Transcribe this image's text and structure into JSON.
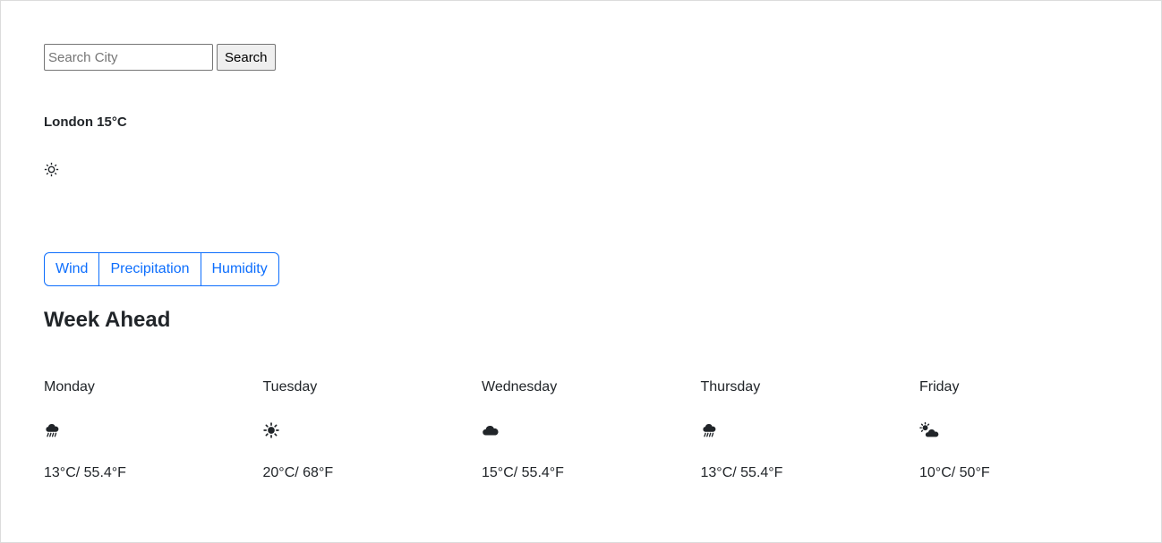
{
  "search": {
    "placeholder": "Search City",
    "button_label": "Search"
  },
  "current": {
    "summary": "London 15°C",
    "icon": "sun-outline-icon"
  },
  "tabs": [
    {
      "label": "Wind"
    },
    {
      "label": "Precipitation"
    },
    {
      "label": "Humidity"
    }
  ],
  "week": {
    "title": "Week Ahead",
    "days": [
      {
        "name": "Monday",
        "icon": "rain-cloud-icon",
        "temp": "13°C/ 55.4°F"
      },
      {
        "name": "Tuesday",
        "icon": "sun-icon",
        "temp": "20°C/ 68°F"
      },
      {
        "name": "Wednesday",
        "icon": "cloud-icon",
        "temp": "15°C/ 55.4°F"
      },
      {
        "name": "Thursday",
        "icon": "rain-cloud-icon",
        "temp": "13°C/ 55.4°F"
      },
      {
        "name": "Friday",
        "icon": "sun-behind-cloud-icon",
        "temp": "10°C/ 50°F"
      }
    ]
  },
  "colors": {
    "accent": "#0d6efd",
    "text": "#212529"
  }
}
